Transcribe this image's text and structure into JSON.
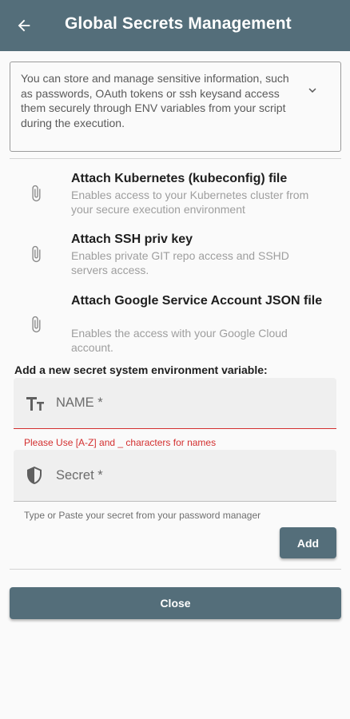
{
  "appbar": {
    "title": "Global Secrets Management",
    "back_icon": "arrow-left-icon",
    "bg_color": "#546e7a"
  },
  "info": {
    "text": "You can store and manage sensitive information, such as passwords, OAuth tokens or ssh keysand access them securely through ENV variables from your script during the execution.",
    "expand_icon": "chevron-down-icon"
  },
  "attachments": [
    {
      "icon": "paperclip-icon",
      "title": "Attach Kubernetes (kubeconfig) file",
      "description": "Enables access to your Kubernetes cluster from your secure execution environment"
    },
    {
      "icon": "paperclip-icon",
      "title": "Attach SSH priv key",
      "description": "Enables private GIT repo access and SSHD servers access."
    },
    {
      "icon": "paperclip-icon",
      "title": "Attach Google Service Account JSON file",
      "description": "Enables the access with your Google Cloud account."
    }
  ],
  "form": {
    "section_label": "Add a new secret system environment variable:",
    "name_field": {
      "icon": "text-format-icon",
      "placeholder": "NAME *",
      "value": "",
      "error": "Please Use [A-Z] and _ characters for names",
      "error_color": "#d32f2f"
    },
    "secret_field": {
      "icon": "shield-icon",
      "placeholder": "Secret *",
      "value": "",
      "helper": "Type or Paste your secret from your password manager"
    },
    "add_label": "Add"
  },
  "close_label": "Close"
}
